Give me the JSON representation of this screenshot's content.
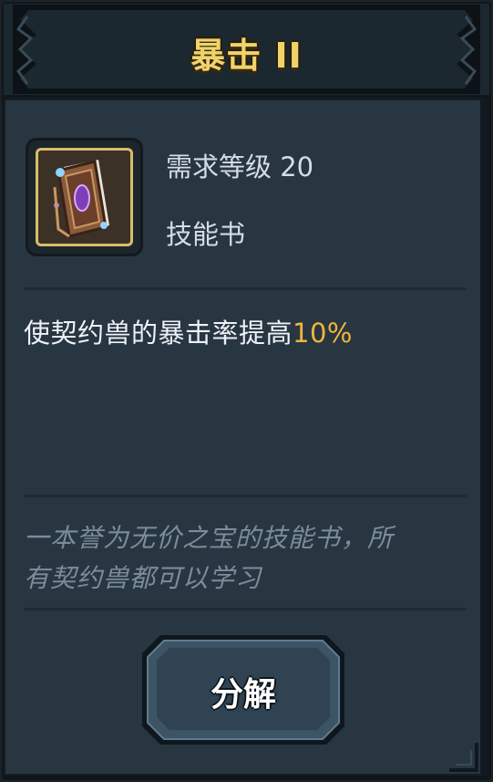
{
  "title": "暴击 II",
  "item": {
    "icon": "skill-book-icon",
    "required_level": "需求等级 20",
    "type": "技能书"
  },
  "description": {
    "prefix": "使契约兽的暴击率提高",
    "highlight": "10%"
  },
  "flavor": {
    "line1": "一本誉为无价之宝的技能书，所",
    "line2": "有契约兽都可以学习"
  },
  "actions": {
    "decompose_label": "分解"
  },
  "colors": {
    "title": "#f0d36c",
    "highlight": "#f0b43c",
    "icon_border": "#d9bc66",
    "panel": "#283641"
  }
}
